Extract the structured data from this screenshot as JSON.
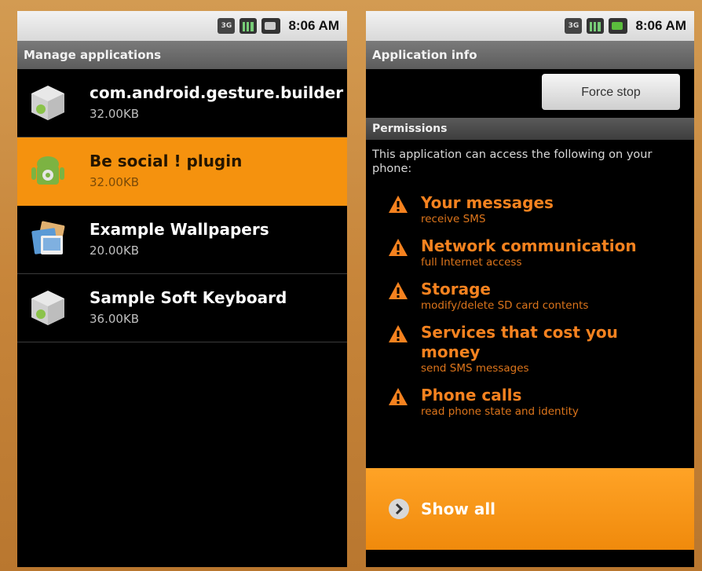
{
  "left": {
    "status_time": "8:06 AM",
    "title": "Manage applications",
    "apps": [
      {
        "name": "com.android.gesture.builder",
        "size": "32.00KB"
      },
      {
        "name": "Be social ! plugin",
        "size": "32.00KB"
      },
      {
        "name": "Example Wallpapers",
        "size": "20.00KB"
      },
      {
        "name": "Sample Soft Keyboard",
        "size": "36.00KB"
      }
    ]
  },
  "right": {
    "status_time": "8:06 AM",
    "title": "Application info",
    "force_stop": "Force stop",
    "permissions_header": "Permissions",
    "intro": "This application can access the following on your phone:",
    "permissions": [
      {
        "title": "Your messages",
        "detail": "receive SMS"
      },
      {
        "title": "Network communication",
        "detail": "full Internet access"
      },
      {
        "title": "Storage",
        "detail": "modify/delete SD card contents"
      },
      {
        "title": "Services that cost you money",
        "detail": "send SMS messages"
      },
      {
        "title": "Phone calls",
        "detail": "read phone state and identity"
      }
    ],
    "show_all": "Show all"
  },
  "colors": {
    "accent": "#f5920e",
    "warning": "#f5821f"
  }
}
